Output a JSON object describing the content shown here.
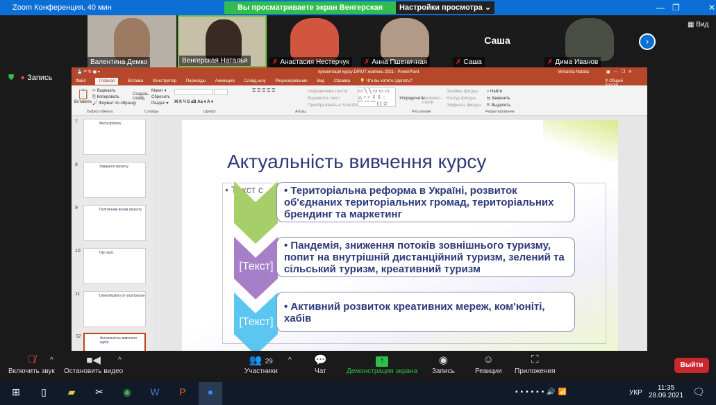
{
  "zoom": {
    "window_title": "Zoom Конференция, 40 мин",
    "banner": "Вы просматриваете экран Венгерская Наталья",
    "view_settings": "Настройки просмотра ⌄",
    "view_button": "Вид",
    "record_label": "Запись",
    "participants": [
      {
        "name": "Валентина Демко",
        "muted": false
      },
      {
        "name": "Венгерская Наталья",
        "muted": false
      },
      {
        "name": "Анастасия Нестерчук",
        "muted": true
      },
      {
        "name": "Анна Пшеничная",
        "muted": true
      },
      {
        "name": "Саша",
        "muted": true,
        "display": "Саша"
      },
      {
        "name": "Дима Иванов",
        "muted": true
      }
    ],
    "toolbar": {
      "audio": "Включить звук",
      "video": "Остановить видео",
      "participants": "Участники",
      "participants_count": "29",
      "chat": "Чат",
      "share": "Демонстрация экрана",
      "record": "Запись",
      "reactions": "Реакции",
      "apps": "Приложения",
      "exit": "Выйти"
    },
    "colors": {
      "share_green": "#2ebd4e",
      "exit_red": "#c8282e",
      "title_blue": "#0b6fd6"
    }
  },
  "ppt": {
    "title": "презентація курсу DIRUT жовтень 2021 - PowerPoint",
    "user": "Verkavita Natalia",
    "tabs": [
      "Файл",
      "Главная",
      "Вставка",
      "Конструктор",
      "Переходы",
      "Анимация",
      "Слайд-шоу",
      "Рецензирование",
      "Вид",
      "Справка",
      "Что вы хотите сделать?"
    ],
    "share": "Общий доступ",
    "ribbon": {
      "paste": "Вставить",
      "cut": "Вырезать",
      "copy": "Копировать",
      "format": "Формат по образцу",
      "clipboard": "Буфер обмена",
      "new_slide": "Создать слайд",
      "layout": "Макет",
      "reset": "Сбросить",
      "section": "Раздел",
      "slides": "Слайды",
      "font": "Шрифт",
      "text_dir": "Направление текста",
      "align_text": "Выровнять текст",
      "smartart": "Преобразовать в SmartArt",
      "paragraph": "Абзац",
      "arrange": "Упорядочить",
      "quick_styles": "Экспресс-стили",
      "fill": "Заливка фигуры",
      "outline": "Контур фигуры",
      "effects": "Эффекты фигуры",
      "drawing": "Рисование",
      "find": "Найти",
      "replace": "Заменить",
      "select": "Выделить",
      "editing": "Редактирование"
    },
    "thumbnails": [
      {
        "n": "7",
        "title": "Мета проекту"
      },
      {
        "n": "8",
        "title": "Завдання проекту"
      },
      {
        "n": "9",
        "title": "Політичний вплив проекту"
      },
      {
        "n": "10",
        "title": "Про курс"
      },
      {
        "n": "11",
        "title": "Diversification of rural tourism"
      },
      {
        "n": "12",
        "title": "Актуальність вивчення курсу"
      }
    ],
    "slide": {
      "title": "Актуальність вивчення курсу",
      "placeholder_bullet": "Текст с",
      "items": [
        {
          "label": "",
          "text": "Територіальна реформа в Україні, розвиток об'єднаних територіальних громад, територіальних брендинг та маркетинг",
          "color": "#a6cf6a"
        },
        {
          "label": "[Текст]",
          "text": "Пандемія, зниження потоків зовнішнього туризму, попит  на внутрішній дистанційний туризм, зелений та сільський туризм, креативний туризм",
          "color": "#a77fc9"
        },
        {
          "label": "[Текст]",
          "text": "Активний розвиток креативних мереж, ком'юніті, хабів",
          "color": "#5bc6f0"
        }
      ]
    }
  },
  "taskbar": {
    "lang": "УКР",
    "time": "11:35",
    "date": "28.09.2021"
  }
}
